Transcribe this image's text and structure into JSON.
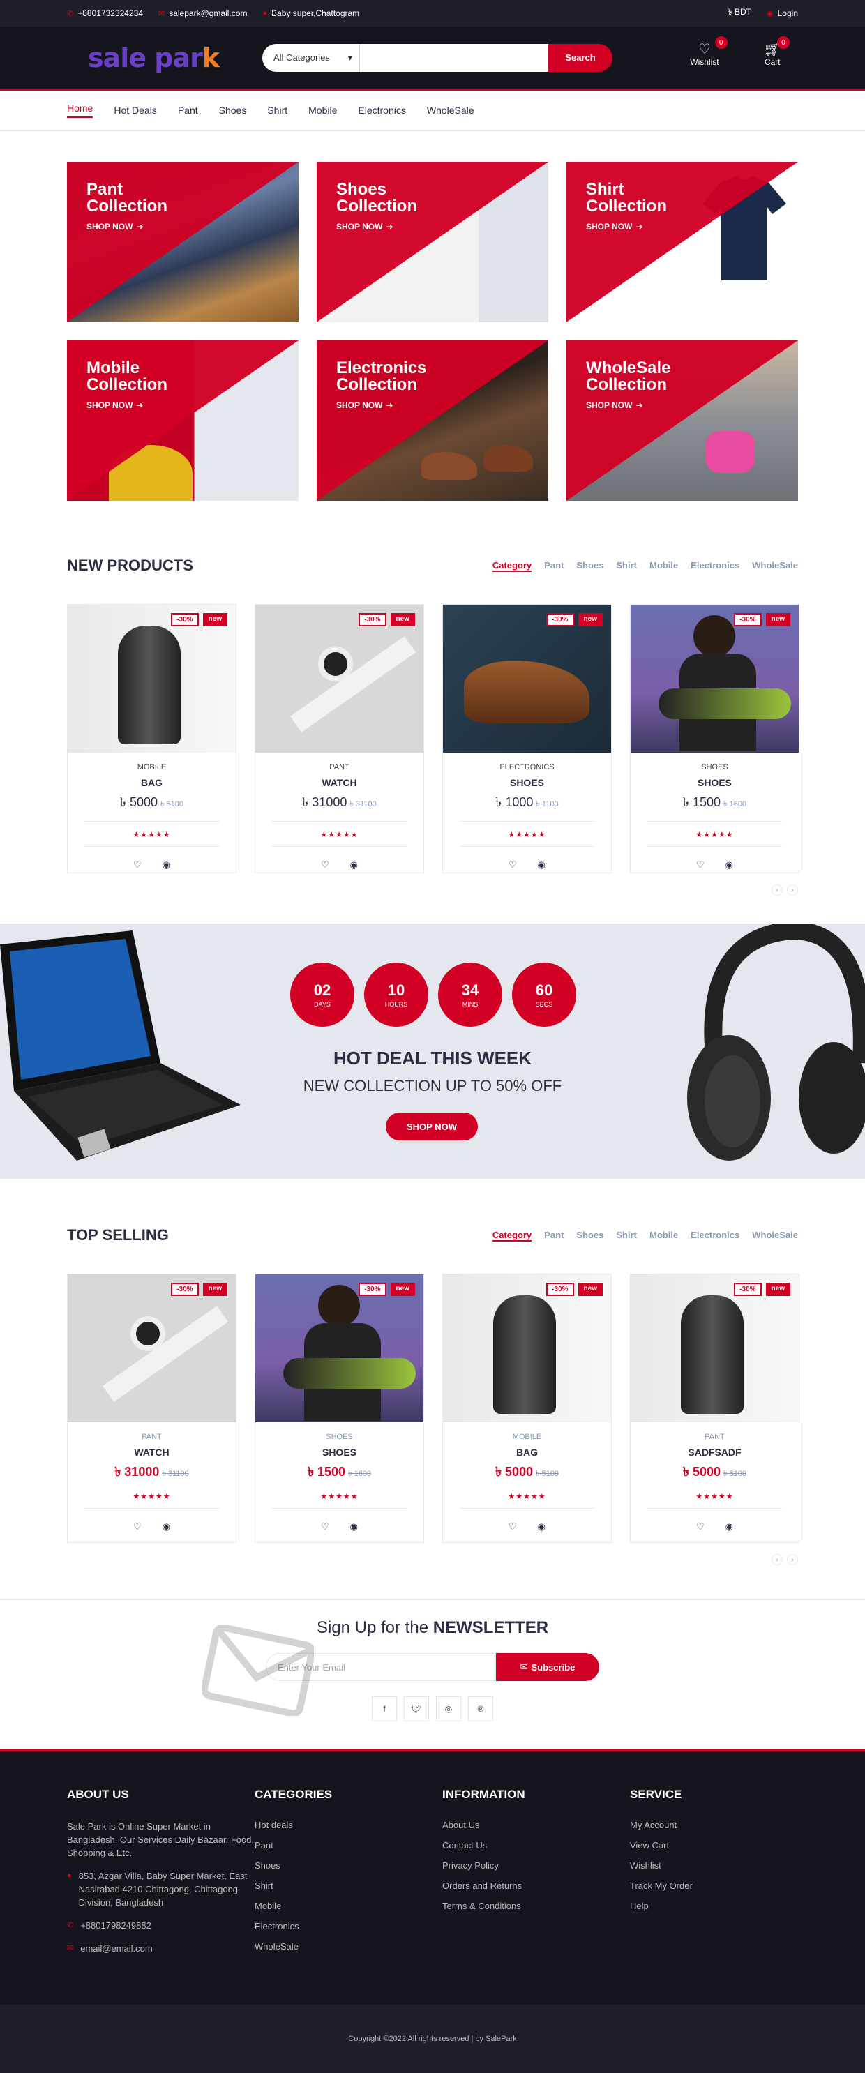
{
  "topbar": {
    "phone": "+8801732324234",
    "email": "salepark@gmail.com",
    "address": "Baby super,Chattogram",
    "currency": "৳ BDT",
    "login": "Login"
  },
  "header": {
    "logo_part1": "sale par",
    "logo_part2": "k",
    "category_select": "All Categories",
    "search_placeholder": "",
    "search_button": "Search",
    "wishlist_label": "Wishlist",
    "wishlist_qty": "0",
    "cart_label": "Cart",
    "cart_qty": "0"
  },
  "nav": [
    "Home",
    "Hot Deals",
    "Pant",
    "Shoes",
    "Shirt",
    "Mobile",
    "Electronics",
    "WholeSale"
  ],
  "collections": [
    {
      "line1": "Pant",
      "line2": "Collection",
      "shop": "SHOP NOW"
    },
    {
      "line1": "Shoes",
      "line2": "Collection",
      "shop": "SHOP NOW"
    },
    {
      "line1": "Shirt",
      "line2": "Collection",
      "shop": "SHOP NOW"
    },
    {
      "line1": "Mobile",
      "line2": "Collection",
      "shop": "SHOP NOW"
    },
    {
      "line1": "Electronics",
      "line2": "Collection",
      "shop": "SHOP NOW"
    },
    {
      "line1": "WholeSale",
      "line2": "Collection",
      "shop": "SHOP NOW"
    }
  ],
  "new_products": {
    "title": "NEW PRODUCTS",
    "tabs": [
      "Category",
      "Pant",
      "Shoes",
      "Shirt",
      "Mobile",
      "Electronics",
      "WholeSale"
    ],
    "items": [
      {
        "badge": "-30%",
        "tag": "new",
        "category": "MOBILE",
        "name": "BAG",
        "price": "৳ 5000",
        "old_price": "৳ 5100",
        "stars": "★★★★★"
      },
      {
        "badge": "-30%",
        "tag": "new",
        "category": "PANT",
        "name": "WATCH",
        "price": "৳ 31000",
        "old_price": "৳ 31100",
        "stars": "★★★★★"
      },
      {
        "badge": "-30%",
        "tag": "new",
        "category": "ELECTRONICS",
        "name": "SHOES",
        "price": "৳ 1000",
        "old_price": "৳ 1100",
        "stars": "★★★★★"
      },
      {
        "badge": "-30%",
        "tag": "new",
        "category": "SHOES",
        "name": "SHOES",
        "price": "৳ 1500",
        "old_price": "৳ 1600",
        "stars": "★★★★★"
      }
    ]
  },
  "hot_deal": {
    "countdown": [
      {
        "value": "02",
        "unit": "DAYS"
      },
      {
        "value": "10",
        "unit": "HOURS"
      },
      {
        "value": "34",
        "unit": "MINS"
      },
      {
        "value": "60",
        "unit": "SECS"
      }
    ],
    "title": "HOT DEAL THIS WEEK",
    "subtitle": "NEW COLLECTION UP TO 50% OFF",
    "button": "SHOP NOW"
  },
  "top_selling": {
    "title": "TOP SELLING",
    "tabs": [
      "Category",
      "Pant",
      "Shoes",
      "Shirt",
      "Mobile",
      "Electronics",
      "WholeSale"
    ],
    "items": [
      {
        "badge": "-30%",
        "tag": "new",
        "category": "PANT",
        "name": "WATCH",
        "price": "৳ 31000",
        "old_price": "৳ 31100",
        "stars": "★★★★★"
      },
      {
        "badge": "-30%",
        "tag": "new",
        "category": "SHOES",
        "name": "SHOES",
        "price": "৳ 1500",
        "old_price": "৳ 1600",
        "stars": "★★★★★"
      },
      {
        "badge": "-30%",
        "tag": "new",
        "category": "MOBILE",
        "name": "BAG",
        "price": "৳ 5000",
        "old_price": "৳ 5100",
        "stars": "★★★★★"
      },
      {
        "badge": "-30%",
        "tag": "new",
        "category": "PANT",
        "name": "SADFSADF",
        "price": "৳ 5000",
        "old_price": "৳ 5100",
        "stars": "★★★★★"
      }
    ]
  },
  "newsletter": {
    "title_pre": "Sign Up for the ",
    "title_bold": "NEWSLETTER",
    "placeholder": "Enter Your Email",
    "button": "Subscribe"
  },
  "footer": {
    "about_title": "ABOUT US",
    "about_text": "Sale Park is Online Super Market in Bangladesh. Our Services Daily Bazaar, Food, Shopping & Etc.",
    "address": "853, Azgar Villa, Baby Super Market, East Nasirabad 4210 Chittagong, Chittagong Division, Bangladesh",
    "phone": "+8801798249882",
    "email": "email@email.com",
    "categories_title": "CATEGORIES",
    "categories": [
      "Hot deals",
      "Pant",
      "Shoes",
      "Shirt",
      "Mobile",
      "Electronics",
      "WholeSale"
    ],
    "information_title": "INFORMATION",
    "information": [
      "About Us",
      "Contact Us",
      "Privacy Policy",
      "Orders and Returns",
      "Terms & Conditions"
    ],
    "service_title": "SERVICE",
    "service": [
      "My Account",
      "View Cart",
      "Wishlist",
      "Track My Order",
      "Help"
    ],
    "copyright": "Copyright ©2022 All rights reserved | by SalePark"
  },
  "colors": {
    "accent": "#d10024",
    "dark": "#15161d",
    "light": "#e4e7ed"
  }
}
